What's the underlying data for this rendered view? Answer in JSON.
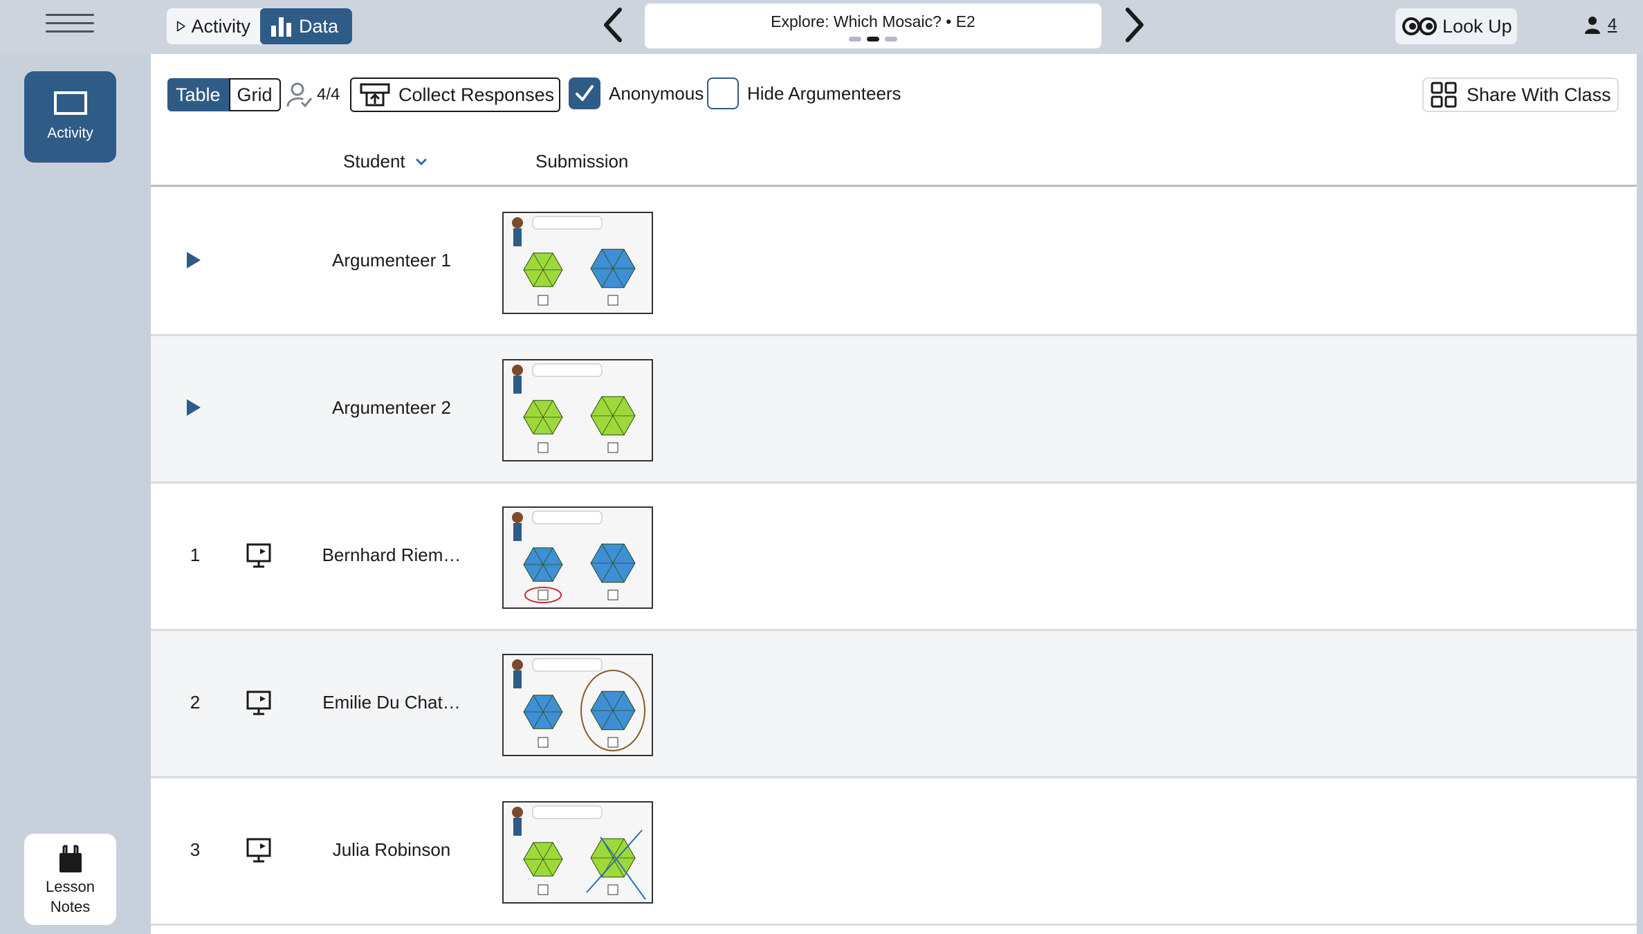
{
  "topbar": {
    "activity_label": "Activity",
    "data_label": "Data",
    "title": "Explore: Which Mosaic? • E2",
    "lookup_label": "Look Up",
    "user_count": "4"
  },
  "sidebar": {
    "activity_label": "Activity",
    "lesson_notes_label": "Lesson Notes"
  },
  "toolbar": {
    "table_label": "Table",
    "grid_label": "Grid",
    "response_count": "4/4",
    "collect_label": "Collect Responses",
    "anonymous_label": "Anonymous",
    "anonymous_checked": true,
    "hide_label": "Hide Argumenteers",
    "hide_checked": false,
    "share_label": "Share With Class"
  },
  "table": {
    "headers": {
      "student": "Student",
      "submission": "Submission"
    },
    "rows": [
      {
        "index": "",
        "type": "argumenteer",
        "name": "Argumenteer 1",
        "variant": "a1"
      },
      {
        "index": "",
        "type": "argumenteer",
        "name": "Argumenteer 2",
        "variant": "a2"
      },
      {
        "index": "1",
        "type": "student",
        "name": "Bernhard Riem…",
        "variant": "s1"
      },
      {
        "index": "2",
        "type": "student",
        "name": "Emilie Du Chat…",
        "variant": "s2"
      },
      {
        "index": "3",
        "type": "student",
        "name": "Julia Robinson",
        "variant": "s3"
      }
    ]
  },
  "colors": {
    "accent": "#2f5b87",
    "green": "#9ed93b",
    "blue": "#3f8fd6"
  }
}
